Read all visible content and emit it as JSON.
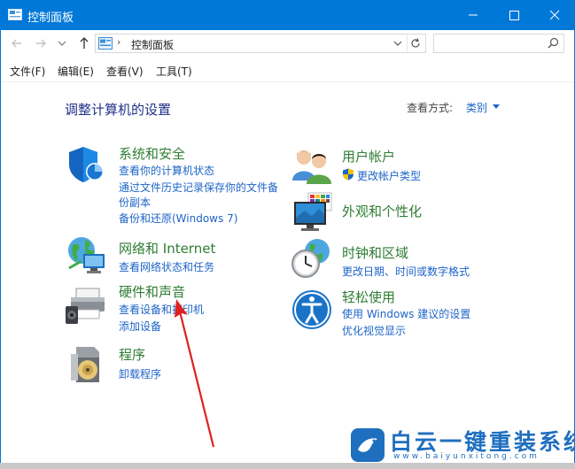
{
  "window": {
    "title": "控制面板"
  },
  "address": {
    "path": "控制面板",
    "separator": "›",
    "dropdown_caret": "⌄",
    "refresh_glyph": "↻"
  },
  "nav": {
    "back": "←",
    "forward": "→",
    "recent": "⌄",
    "up": "↑"
  },
  "menu": {
    "file": "文件(F)",
    "edit": "编辑(E)",
    "view": "查看(V)",
    "tools": "工具(T)"
  },
  "header": {
    "title": "调整计算机的设置",
    "view_by_label": "查看方式:",
    "view_by_value": "类别"
  },
  "categories": {
    "system_security": {
      "title": "系统和安全",
      "links": [
        "查看你的计算机状态",
        "通过文件历史记录保存你的文件备",
        "份副本",
        "备份和还原(Windows 7)"
      ]
    },
    "network": {
      "title": "网络和 Internet",
      "links": [
        "查看网络状态和任务"
      ]
    },
    "hardware": {
      "title": "硬件和声音",
      "links": [
        "查看设备和打印机",
        "添加设备"
      ]
    },
    "programs": {
      "title": "程序",
      "links": [
        "卸载程序"
      ]
    },
    "user_accounts": {
      "title": "用户帐户",
      "links": [
        "更改帐户类型"
      ]
    },
    "appearance": {
      "title": "外观和个性化",
      "links": []
    },
    "clock_region": {
      "title": "时钟和区域",
      "links": [
        "更改日期、时间或数字格式"
      ]
    },
    "ease_access": {
      "title": "轻松使用",
      "links": [
        "使用 Windows 建议的设置",
        "优化视觉显示"
      ]
    }
  },
  "watermark": {
    "text": "白云一键重装系统",
    "url": "www.baiyunxitong.com"
  },
  "colors": {
    "titlebar": "#0078d7",
    "link": "#1e64c8",
    "category_title": "#2e7d32",
    "annotation": "#e02020"
  }
}
